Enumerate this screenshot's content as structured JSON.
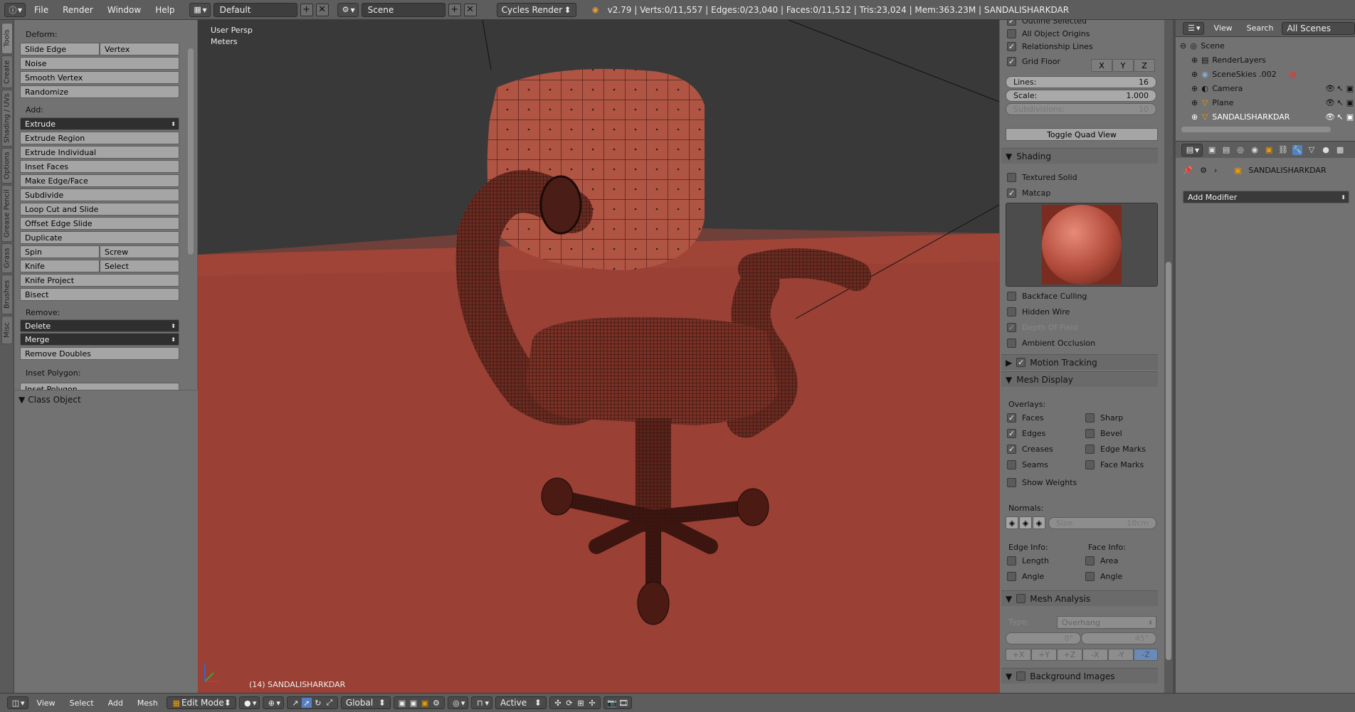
{
  "topbar": {
    "menus": [
      "File",
      "Render",
      "Window",
      "Help"
    ],
    "layout": "Default",
    "scene": "Scene",
    "engine": "Cycles Render",
    "stats": "v2.79 | Verts:0/11,557 | Edges:0/23,040 | Faces:0/11,512 | Tris:23,024 | Mem:363.23M | SANDALISHARKDAR"
  },
  "left_tabs": [
    "Tools",
    "Create",
    "Shading / UVs",
    "Options",
    "Grease Pencil",
    "Grass",
    "Brushes",
    "Misc"
  ],
  "tools": {
    "deform_label": "Deform:",
    "slide_edge": "Slide Edge",
    "vertex": "Vertex",
    "noise": "Noise",
    "smooth_vertex": "Smooth Vertex",
    "randomize": "Randomize",
    "add_label": "Add:",
    "extrude": "Extrude",
    "extrude_region": "Extrude Region",
    "extrude_individual": "Extrude Individual",
    "inset_faces": "Inset Faces",
    "make_edge_face": "Make Edge/Face",
    "subdivide": "Subdivide",
    "loop_cut": "Loop Cut and Slide",
    "offset_edge": "Offset Edge Slide",
    "duplicate": "Duplicate",
    "spin": "Spin",
    "screw": "Screw",
    "knife": "Knife",
    "select": "Select",
    "knife_project": "Knife Project",
    "bisect": "Bisect",
    "remove_label": "Remove:",
    "delete": "Delete",
    "merge": "Merge",
    "remove_doubles": "Remove Doubles",
    "inset_polygon_label": "Inset Polygon:",
    "inset_polygon": "Inset Polygon"
  },
  "class_object": "Class Object",
  "viewport": {
    "view_name": "User Persp",
    "units": "Meters",
    "object_label": "(14) SANDALISHARKDAR"
  },
  "nprops": {
    "outline_selected": "Outline Selected",
    "all_object_origins": "All Object Origins",
    "relationship_lines": "Relationship Lines",
    "grid_floor": "Grid Floor",
    "axes": [
      "X",
      "Y",
      "Z"
    ],
    "lines_label": "Lines:",
    "lines_value": "16",
    "scale_label": "Scale:",
    "scale_value": "1.000",
    "subdiv_label": "Subdivisions:",
    "subdiv_value": "10",
    "toggle_quad": "Toggle Quad View",
    "shading": "Shading",
    "textured_solid": "Textured Solid",
    "matcap": "Matcap",
    "backface": "Backface Culling",
    "hidden_wire": "Hidden Wire",
    "dof": "Depth Of Field",
    "ao": "Ambient Occlusion",
    "motion_tracking": "Motion Tracking",
    "mesh_display": "Mesh Display",
    "overlays": "Overlays:",
    "faces": "Faces",
    "sharp": "Sharp",
    "edges": "Edges",
    "bevel": "Bevel",
    "creases": "Creases",
    "edge_marks": "Edge Marks",
    "seams": "Seams",
    "face_marks": "Face Marks",
    "show_weights": "Show Weights",
    "normals": "Normals:",
    "size_label": "Size:",
    "size_value": "10cm",
    "edge_info": "Edge Info:",
    "face_info": "Face Info:",
    "length": "Length",
    "area": "Area",
    "angle": "Angle",
    "angle2": "Angle",
    "mesh_analysis": "Mesh Analysis",
    "type_label": "Type:",
    "type_value": "Overhang",
    "min_angle": "0°",
    "max_angle": "45°",
    "dirs": [
      "+X",
      "+Y",
      "+Z",
      "-X",
      "-Y",
      "-Z"
    ],
    "background_images": "Background Images"
  },
  "outliner": {
    "menus": [
      "View",
      "Search"
    ],
    "filter": "All Scenes",
    "items": [
      "Scene",
      "RenderLayers",
      "SceneSkies .002",
      "Camera",
      "Plane",
      "SANDALISHARKDAR"
    ]
  },
  "properties": {
    "object": "SANDALISHARKDAR",
    "add_modifier": "Add Modifier"
  },
  "bottombar": {
    "menus": [
      "View",
      "Select",
      "Add",
      "Mesh"
    ],
    "mode": "Edit Mode",
    "orientation": "Global",
    "pivot": "Active"
  },
  "colors": {
    "floor": "#9a4034",
    "mesh": "#b05444",
    "background": "#393939",
    "panel": "#727272"
  }
}
